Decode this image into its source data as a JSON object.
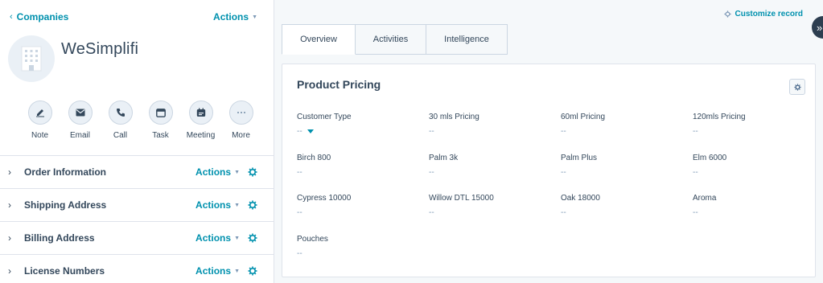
{
  "left": {
    "back_label": "Companies",
    "actions_label": "Actions",
    "company_name": "WeSimplifi",
    "quick_actions": [
      {
        "label": "Note",
        "icon": "note-icon"
      },
      {
        "label": "Email",
        "icon": "email-icon"
      },
      {
        "label": "Call",
        "icon": "call-icon"
      },
      {
        "label": "Task",
        "icon": "task-icon"
      },
      {
        "label": "Meeting",
        "icon": "meeting-icon"
      },
      {
        "label": "More",
        "icon": "more-icon"
      }
    ],
    "sections": [
      {
        "title": "Order Information",
        "actions": "Actions"
      },
      {
        "title": "Shipping Address",
        "actions": "Actions"
      },
      {
        "title": "Billing Address",
        "actions": "Actions"
      },
      {
        "title": "License Numbers",
        "actions": "Actions"
      }
    ]
  },
  "right": {
    "customize_label": "Customize record",
    "collapse_glyph": "»",
    "tabs": [
      {
        "label": "Overview",
        "active": true
      },
      {
        "label": "Activities",
        "active": false
      },
      {
        "label": "Intelligence",
        "active": false
      }
    ],
    "card": {
      "title": "Product Pricing",
      "properties": [
        {
          "label": "Customer Type",
          "value": "--"
        },
        {
          "label": "30 mls Pricing",
          "value": "--"
        },
        {
          "label": "60ml Pricing",
          "value": "--"
        },
        {
          "label": "120mls Pricing",
          "value": "--"
        },
        {
          "label": "Birch 800",
          "value": "--"
        },
        {
          "label": "Palm 3k",
          "value": "--"
        },
        {
          "label": "Palm Plus",
          "value": "--"
        },
        {
          "label": "Elm 6000",
          "value": "--"
        },
        {
          "label": "Cypress 10000",
          "value": "--"
        },
        {
          "label": "Willow DTL 15000",
          "value": "--"
        },
        {
          "label": "Oak 18000",
          "value": "--"
        },
        {
          "label": "Aroma",
          "value": "--"
        },
        {
          "label": "Pouches",
          "value": "--"
        }
      ]
    }
  },
  "colors": {
    "accent": "#0091ae",
    "text": "#33475b",
    "muted": "#7c98b6",
    "border": "#dfe3eb",
    "panel_bg": "#f5f8fa",
    "icon_bg": "#eaf0f6",
    "dark_button": "#2d3e50"
  }
}
